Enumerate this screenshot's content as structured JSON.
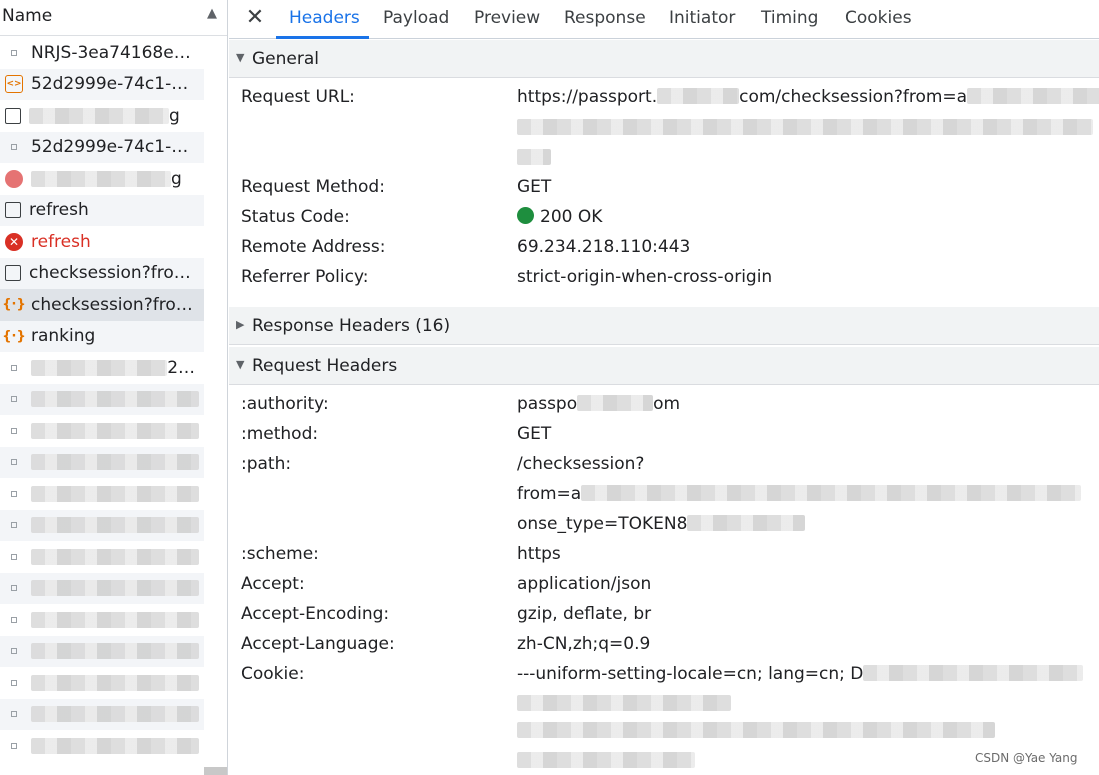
{
  "request_list": {
    "header": "Name",
    "sort_indicator": "▲",
    "rows": [
      {
        "icon": "document",
        "label": "NRJS-3ea74168e28...",
        "blurred": false
      },
      {
        "icon": "script",
        "label": "52d2999e-74c1-42...",
        "blurred": false
      },
      {
        "icon": "image",
        "label": "g",
        "blurred": true
      },
      {
        "icon": "document",
        "label": "52d2999e-74c1-42...",
        "blurred": false
      },
      {
        "icon": "image-red",
        "label": "g",
        "blurred": true
      },
      {
        "icon": "checkbox",
        "label": "refresh",
        "blurred": false
      },
      {
        "icon": "error",
        "label": "refresh",
        "blurred": false,
        "error": true
      },
      {
        "icon": "checkbox",
        "label": "checksession?from...",
        "blurred": false
      },
      {
        "icon": "json",
        "label": "checksession?from...",
        "blurred": false,
        "selected": true
      },
      {
        "icon": "json",
        "label": "ranking",
        "blurred": false
      },
      {
        "icon": "document",
        "label": "28...",
        "blurred": true
      },
      {
        "icon": "document",
        "label": "",
        "blurred": true
      },
      {
        "icon": "document",
        "label": "",
        "blurred": true
      },
      {
        "icon": "document",
        "label": "",
        "blurred": true
      },
      {
        "icon": "document",
        "label": "",
        "blurred": true
      },
      {
        "icon": "document",
        "label": "",
        "blurred": true
      },
      {
        "icon": "document",
        "label": "",
        "blurred": true
      },
      {
        "icon": "document",
        "label": "",
        "blurred": true
      },
      {
        "icon": "document",
        "label": "",
        "blurred": true
      },
      {
        "icon": "document",
        "label": "",
        "blurred": true
      },
      {
        "icon": "document",
        "label": "",
        "blurred": true
      },
      {
        "icon": "document",
        "label": "",
        "blurred": true
      },
      {
        "icon": "document",
        "label": "",
        "blurred": true
      }
    ]
  },
  "tabs": {
    "close_symbol": "✕",
    "items": [
      "Headers",
      "Payload",
      "Preview",
      "Response",
      "Initiator",
      "Timing",
      "Cookies"
    ],
    "active": "Headers"
  },
  "general": {
    "title": "General",
    "expanded": true,
    "request_url_label": "Request URL:",
    "request_url_line1": "https://passport.",
    "request_url_line1b": "com/checksession?from=a",
    "request_method_label": "Request Method:",
    "request_method": "GET",
    "status_code_label": "Status Code:",
    "status_code": "200 OK",
    "status_color": "#1e8e3e",
    "remote_address_label": "Remote Address:",
    "remote_address": "69.234.218.110:443",
    "referrer_policy_label": "Referrer Policy:",
    "referrer_policy": "strict-origin-when-cross-origin"
  },
  "response_headers": {
    "title": "Response Headers (16)",
    "expanded": false
  },
  "request_headers": {
    "title": "Request Headers",
    "expanded": true,
    "authority_label": ":authority:",
    "authority_a": "passpo",
    "authority_b": "om",
    "method_label": ":method:",
    "method": "GET",
    "path_label": ":path:",
    "path_line1": "/checksession?",
    "path_line2": "from=a",
    "path_line3": "onse_type=TOKEN8",
    "scheme_label": ":scheme:",
    "scheme": "https",
    "accept_label": "Accept:",
    "accept": "application/json",
    "accept_encoding_label": "Accept-Encoding:",
    "accept_encoding": "gzip, deflate, br",
    "accept_language_label": "Accept-Language:",
    "accept_language": "zh-CN,zh;q=0.9",
    "cookie_label": "Cookie:",
    "cookie_line1": "---uniform-setting-locale=cn; lang=cn; D"
  },
  "watermark": "CSDN @Yae Yang",
  "colors": {
    "accent": "#1a73e8",
    "error": "#d93025",
    "json_icon": "#e37400"
  }
}
